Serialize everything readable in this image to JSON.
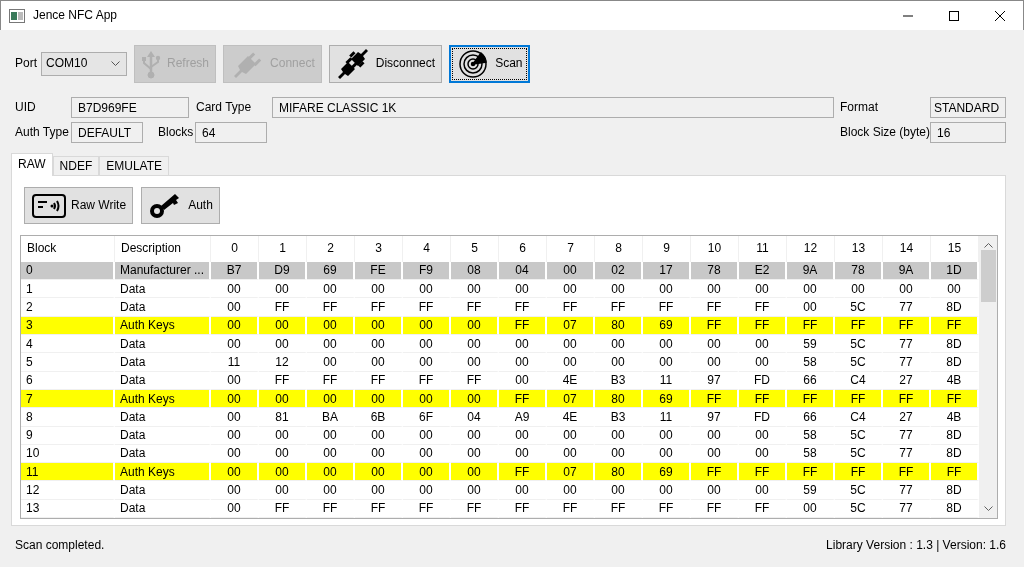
{
  "window": {
    "title": "Jence NFC App"
  },
  "toolbar": {
    "port_label": "Port",
    "port_value": "COM10",
    "buttons": [
      {
        "kind": "usb",
        "label": "Refresh",
        "disabled": true,
        "focused": false
      },
      {
        "kind": "plug",
        "label": "Connect",
        "disabled": true,
        "focused": false
      },
      {
        "kind": "unplug",
        "label": "Disconnect",
        "disabled": false,
        "focused": false
      },
      {
        "kind": "radar",
        "label": "Scan",
        "disabled": false,
        "focused": true
      }
    ]
  },
  "info": {
    "uid": {
      "label": "UID",
      "value": "B7D969FE"
    },
    "card_type": {
      "label": "Card Type",
      "value": "MIFARE CLASSIC 1K"
    },
    "format": {
      "label": "Format",
      "value": "STANDARD"
    },
    "auth_type": {
      "label": "Auth Type",
      "value": "DEFAULT"
    },
    "blocks": {
      "label": "Blocks",
      "value": "64"
    },
    "block_size": {
      "label": "Block Size (byte)",
      "value": "16"
    }
  },
  "tabs": [
    {
      "label": "RAW",
      "selected": true
    },
    {
      "label": "NDEF",
      "selected": false
    },
    {
      "label": "EMULATE",
      "selected": false
    }
  ],
  "panel_buttons": [
    {
      "kind": "card",
      "label": "Raw Write"
    },
    {
      "kind": "key",
      "label": "Auth"
    }
  ],
  "table": {
    "columns": [
      "Block",
      "Description",
      "0",
      "1",
      "2",
      "3",
      "4",
      "5",
      "6",
      "7",
      "8",
      "9",
      "10",
      "11",
      "12",
      "13",
      "14",
      "15"
    ],
    "rows": [
      {
        "kind": "manufacturer",
        "block": "0",
        "description": "Manufacturer ...",
        "bytes": [
          "B7",
          "D9",
          "69",
          "FE",
          "F9",
          "08",
          "04",
          "00",
          "02",
          "17",
          "78",
          "E2",
          "9A",
          "78",
          "9A",
          "1D"
        ]
      },
      {
        "kind": "data",
        "block": "1",
        "description": "Data",
        "bytes": [
          "00",
          "00",
          "00",
          "00",
          "00",
          "00",
          "00",
          "00",
          "00",
          "00",
          "00",
          "00",
          "00",
          "00",
          "00",
          "00"
        ]
      },
      {
        "kind": "data",
        "block": "2",
        "description": "Data",
        "bytes": [
          "00",
          "FF",
          "FF",
          "FF",
          "FF",
          "FF",
          "FF",
          "FF",
          "FF",
          "FF",
          "FF",
          "FF",
          "00",
          "5C",
          "77",
          "8D"
        ]
      },
      {
        "kind": "trailer",
        "block": "3",
        "description": "Auth Keys",
        "bytes": [
          "00",
          "00",
          "00",
          "00",
          "00",
          "00",
          "FF",
          "07",
          "80",
          "69",
          "FF",
          "FF",
          "FF",
          "FF",
          "FF",
          "FF"
        ]
      },
      {
        "kind": "data",
        "block": "4",
        "description": "Data",
        "bytes": [
          "00",
          "00",
          "00",
          "00",
          "00",
          "00",
          "00",
          "00",
          "00",
          "00",
          "00",
          "00",
          "59",
          "5C",
          "77",
          "8D"
        ]
      },
      {
        "kind": "data",
        "block": "5",
        "description": "Data",
        "bytes": [
          "11",
          "12",
          "00",
          "00",
          "00",
          "00",
          "00",
          "00",
          "00",
          "00",
          "00",
          "00",
          "58",
          "5C",
          "77",
          "8D"
        ]
      },
      {
        "kind": "data",
        "block": "6",
        "description": "Data",
        "bytes": [
          "00",
          "FF",
          "FF",
          "FF",
          "FF",
          "FF",
          "00",
          "4E",
          "B3",
          "11",
          "97",
          "FD",
          "66",
          "C4",
          "27",
          "4B"
        ]
      },
      {
        "kind": "trailer",
        "block": "7",
        "description": "Auth Keys",
        "bytes": [
          "00",
          "00",
          "00",
          "00",
          "00",
          "00",
          "FF",
          "07",
          "80",
          "69",
          "FF",
          "FF",
          "FF",
          "FF",
          "FF",
          "FF"
        ]
      },
      {
        "kind": "data",
        "block": "8",
        "description": "Data",
        "bytes": [
          "00",
          "81",
          "BA",
          "6B",
          "6F",
          "04",
          "A9",
          "4E",
          "B3",
          "11",
          "97",
          "FD",
          "66",
          "C4",
          "27",
          "4B"
        ]
      },
      {
        "kind": "data",
        "block": "9",
        "description": "Data",
        "bytes": [
          "00",
          "00",
          "00",
          "00",
          "00",
          "00",
          "00",
          "00",
          "00",
          "00",
          "00",
          "00",
          "58",
          "5C",
          "77",
          "8D"
        ]
      },
      {
        "kind": "data",
        "block": "10",
        "description": "Data",
        "bytes": [
          "00",
          "00",
          "00",
          "00",
          "00",
          "00",
          "00",
          "00",
          "00",
          "00",
          "00",
          "00",
          "58",
          "5C",
          "77",
          "8D"
        ]
      },
      {
        "kind": "trailer",
        "block": "11",
        "description": "Auth Keys",
        "bytes": [
          "00",
          "00",
          "00",
          "00",
          "00",
          "00",
          "FF",
          "07",
          "80",
          "69",
          "FF",
          "FF",
          "FF",
          "FF",
          "FF",
          "FF"
        ]
      },
      {
        "kind": "data",
        "block": "12",
        "description": "Data",
        "bytes": [
          "00",
          "00",
          "00",
          "00",
          "00",
          "00",
          "00",
          "00",
          "00",
          "00",
          "00",
          "00",
          "59",
          "5C",
          "77",
          "8D"
        ]
      },
      {
        "kind": "data",
        "block": "13",
        "description": "Data",
        "bytes": [
          "00",
          "FF",
          "FF",
          "FF",
          "FF",
          "FF",
          "FF",
          "FF",
          "FF",
          "FF",
          "FF",
          "FF",
          "00",
          "5C",
          "77",
          "8D"
        ]
      }
    ]
  },
  "status_bar": {
    "message": "Scan completed.",
    "version": "Library Version : 1.3 | Version: 1.6"
  }
}
